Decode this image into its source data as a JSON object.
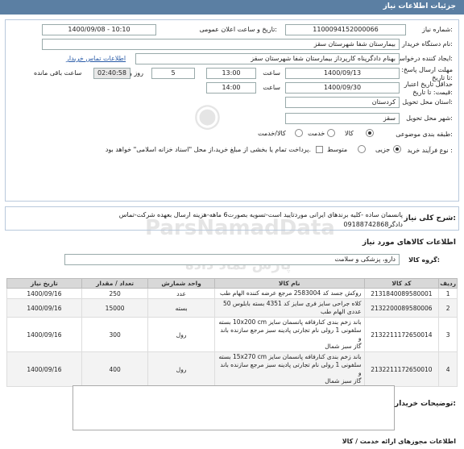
{
  "header": {
    "title": "جزئیات اطلاعات نیاز"
  },
  "form": {
    "need_number_label": "شماره نیاز:",
    "need_number": "1100094152000066",
    "announce_label": "تاریخ و ساعت اعلان عمومی:",
    "announce_value": "1400/09/08 - 10:10",
    "buyer_label": "نام دستگاه خریدار:",
    "buyer_value": "بیمارستان شفا شهرستان سقز",
    "creator_label": "ایجاد کننده درخواست:",
    "creator_value": "بهنام دادگرپناه کارپرداز بیمارستان شفا شهرستان سقز",
    "contact_link": "اطلاعات تماس خریدار",
    "deadline_label": "مهلت ارسال پاسخ: تا تاریخ:",
    "deadline_date": "1400/09/13",
    "deadline_time_label": "ساعت",
    "deadline_time": "13:00",
    "days": "5",
    "days_label": "روز و",
    "remaining": "02:40:58",
    "remaining_label": "ساعت باقی مانده",
    "validity_label": "حداقل تاریخ اعتبار قیمت: تا تاریخ:",
    "validity_date": "1400/09/30",
    "validity_time_label": "ساعت",
    "validity_time": "14:00",
    "province_label": "استان محل تحویل:",
    "province_value": "کردستان",
    "city_label": "شهر محل تحویل:",
    "city_value": "سقز",
    "category_label": "طبقه بندی موضوعی:",
    "category_options": [
      "کالا",
      "خدمت",
      "کالا/خدمت"
    ],
    "payment_label": "نوع فرآیند خرید :",
    "payment_options": [
      "جزیی",
      "متوسط"
    ],
    "payment_note": "پرداخت تمام یا بخشی از مبلغ خرید،از محل \"اسناد خزانه اسلامی\" خواهد بود."
  },
  "summary": {
    "label": "شرح کلی نیاز:",
    "text_line1": "پانسمان ساده -کلیه برندهای ایرانی موردتایید است-تسویه بصورت6 ماهه-هزینه ارسال بعهده شرکت-تماس",
    "text_line2": "دادگر09188742868"
  },
  "goods": {
    "section_title": "اطلاعات کالاهای مورد نیاز",
    "group_label": "گروه کالا:",
    "group_value": "دارو، پزشکی و سلامت",
    "columns": [
      "ردیف",
      "کد کالا",
      "نام کالا",
      "واحد شمارش",
      "تعداد / مقدار",
      "تاریخ نیاز"
    ],
    "rows": [
      {
        "idx": "1",
        "code": "2131840089580001",
        "name": [
          "روکش جسد کد 2583004 مرجع عرضه کننده الهام طب"
        ],
        "unit": "عدد",
        "qty": "250",
        "date": "1400/09/16"
      },
      {
        "idx": "2",
        "code": "2132200089580006",
        "name": [
          "کلاه جراحی سایز فری سایز کد 4351 بسته بابلوس 50",
          "عددی الهام طب"
        ],
        "unit": "بسته",
        "qty": "15000",
        "date": "1400/09/16"
      },
      {
        "idx": "3",
        "code": "2132211172650014",
        "name": [
          "باند زخم بندی کنارفافه پانسمان سایز 10x200 cm بسته",
          "سلفونی 1 رولی نام تجارتی پادینه سبز مرجع سازنده باند و",
          "گاز سبز شمال"
        ],
        "unit": "رول",
        "qty": "300",
        "date": "1400/09/16"
      },
      {
        "idx": "4",
        "code": "2132211172650010",
        "name": [
          "باند زخم بندی کنارفافه پانسمان سایز 15x270 cm بسته",
          "سلفونی 1 رولی نام تجارتی پادینه سبز مرجع سازنده باند و",
          "گاز سبز شمال"
        ],
        "unit": "رول",
        "qty": "400",
        "date": "1400/09/16"
      }
    ]
  },
  "buyer_notes": {
    "label": "توضیحات خریدار:"
  },
  "footer": {
    "text": "اطلاعات مجوزهای ارائه خدمت / کالا"
  },
  "watermark": {
    "text": "ParsNamadData",
    "sub": "پارس نماد داده"
  }
}
